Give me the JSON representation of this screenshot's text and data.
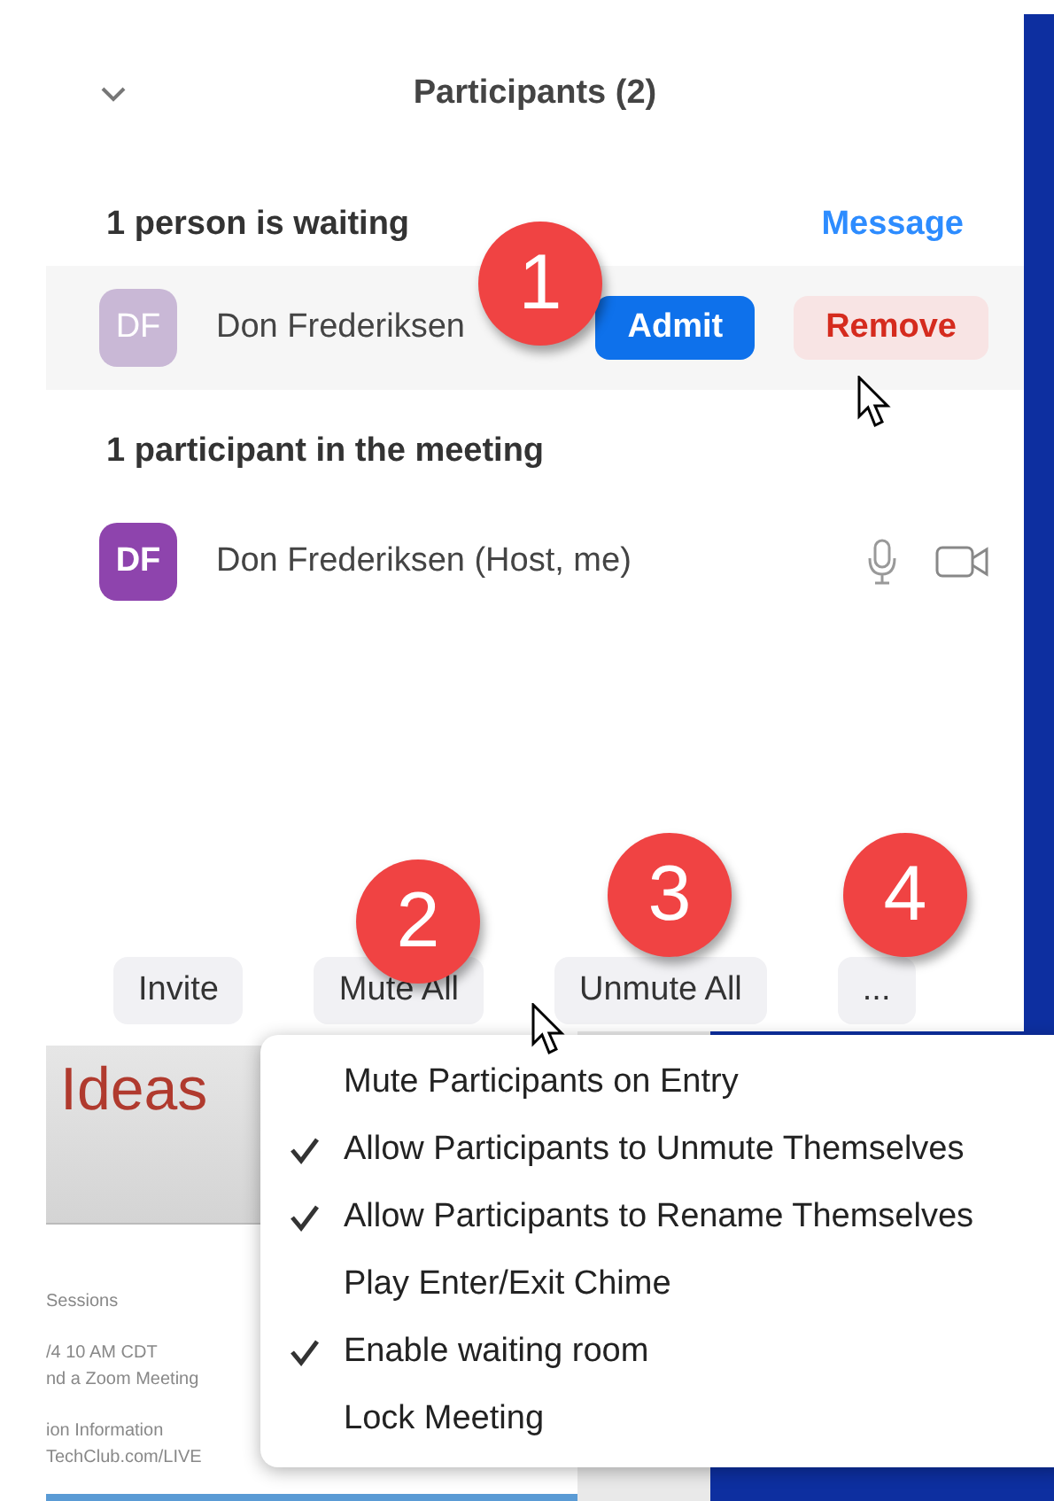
{
  "header": {
    "title": "Participants (2)"
  },
  "waiting": {
    "heading": "1 person is waiting",
    "message_link": "Message",
    "person": {
      "initials": "DF",
      "name": "Don Frederiksen",
      "admit": "Admit",
      "remove": "Remove"
    }
  },
  "in_meeting": {
    "heading": "1 participant in the meeting",
    "person": {
      "initials": "DF",
      "name": "Don Frederiksen (Host, me)"
    }
  },
  "toolbar": [
    "Invite",
    "Mute All",
    "Unmute All",
    "..."
  ],
  "slide": {
    "title": "Ideas",
    "lines": [
      "Sessions",
      "/4 10 AM CDT",
      "nd a Zoom Meeting",
      "ion Information",
      "TechClub.com/LIVE"
    ]
  },
  "menu": [
    {
      "label": "Mute Participants on Entry",
      "checked": false
    },
    {
      "label": "Allow Participants to Unmute Themselves",
      "checked": true
    },
    {
      "label": "Allow Participants to Rename Themselves",
      "checked": true
    },
    {
      "label": "Play Enter/Exit Chime",
      "checked": false
    },
    {
      "label": "Enable waiting room",
      "checked": true
    },
    {
      "label": "Lock Meeting",
      "checked": false
    }
  ],
  "callouts": [
    "1",
    "2",
    "3",
    "4"
  ]
}
